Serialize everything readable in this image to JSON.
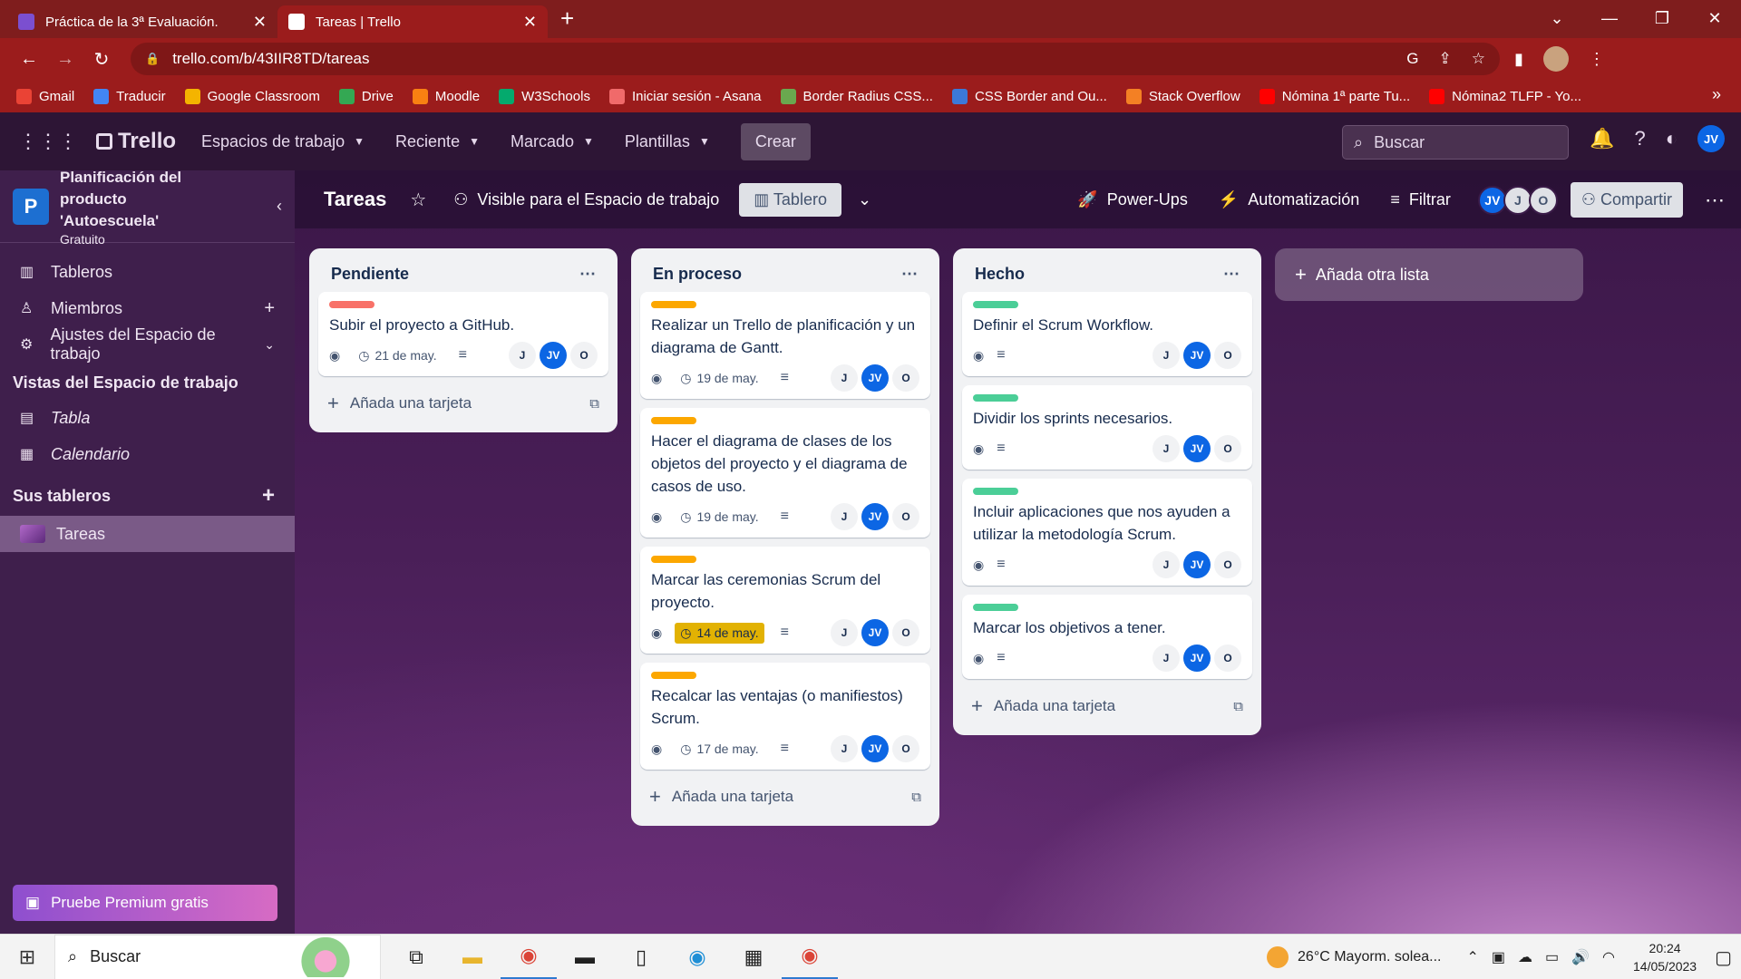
{
  "browser": {
    "tabs": [
      {
        "title": "Práctica de la 3ª Evaluación.",
        "active": false,
        "favicon_color": "#7b4fd0"
      },
      {
        "title": "Tareas | Trello",
        "active": true,
        "favicon_color": "#ffffff"
      }
    ],
    "url": "trello.com/b/43IIR8TD/tareas",
    "bookmarks": [
      {
        "label": "Gmail",
        "color": "#ea4335"
      },
      {
        "label": "Traducir",
        "color": "#4285f4"
      },
      {
        "label": "Google Classroom",
        "color": "#f4b400"
      },
      {
        "label": "Drive",
        "color": "#34a853"
      },
      {
        "label": "Moodle",
        "color": "#f98012"
      },
      {
        "label": "W3Schools",
        "color": "#04aa6d"
      },
      {
        "label": "Iniciar sesión - Asana",
        "color": "#f06a6a"
      },
      {
        "label": "Border Radius CSS...",
        "color": "#6aa84f"
      },
      {
        "label": "CSS Border and Ou...",
        "color": "#3c78d8"
      },
      {
        "label": "Stack Overflow",
        "color": "#f48024"
      },
      {
        "label": "Nómina 1ª parte Tu...",
        "color": "#ff0000"
      },
      {
        "label": "Nómina2 TLFP - Yo...",
        "color": "#ff0000"
      }
    ]
  },
  "header": {
    "logo": "Trello",
    "menus": [
      "Espacios de trabajo",
      "Reciente",
      "Marcado",
      "Plantillas"
    ],
    "create": "Crear",
    "search_placeholder": "Buscar",
    "avatar": "JV"
  },
  "sidebar": {
    "workspace_name": "Planificación del producto 'Autoescuela'",
    "workspace_initial": "P",
    "workspace_plan": "Gratuito",
    "nav": [
      "Tableros",
      "Miembros",
      "Ajustes del Espacio de trabajo"
    ],
    "views_title": "Vistas del Espacio de trabajo",
    "views": [
      "Tabla",
      "Calendario"
    ],
    "boards_title": "Sus tableros",
    "boards": [
      "Tareas"
    ],
    "premium": "Pruebe Premium gratis"
  },
  "board": {
    "title": "Tareas",
    "visibility": "Visible para el Espacio de trabajo",
    "view": "Tablero",
    "powerups": "Power-Ups",
    "automation": "Automatización",
    "filter": "Filtrar",
    "members": [
      "JV",
      "J",
      "O"
    ],
    "share": "Compartir",
    "add_list": "Añada otra lista",
    "add_card": "Añada una tarjeta"
  },
  "lists": [
    {
      "name": "Pendiente",
      "cards": [
        {
          "label_color": "#f87168",
          "title": "Subir el proyecto a GitHub.",
          "due": "21 de may.",
          "due_warn": false
        }
      ]
    },
    {
      "name": "En proceso",
      "cards": [
        {
          "label_color": "#fca700",
          "title": "Realizar un Trello de planificación y un diagrama de Gantt.",
          "due": "19 de may.",
          "due_warn": false
        },
        {
          "label_color": "#fca700",
          "title": "Hacer el diagrama de clases de los objetos del proyecto y el diagrama de casos de uso.",
          "due": "19 de may.",
          "due_warn": false
        },
        {
          "label_color": "#fca700",
          "title": "Marcar las ceremonias Scrum del proyecto.",
          "due": "14 de may.",
          "due_warn": true
        },
        {
          "label_color": "#fca700",
          "title": "Recalcar las ventajas (o manifiestos) Scrum.",
          "due": "17 de may.",
          "due_warn": false
        }
      ]
    },
    {
      "name": "Hecho",
      "cards": [
        {
          "label_color": "#4bce97",
          "title": "Definir el Scrum Workflow.",
          "due": "",
          "due_warn": false
        },
        {
          "label_color": "#4bce97",
          "title": "Dividir los sprints necesarios.",
          "due": "",
          "due_warn": false
        },
        {
          "label_color": "#4bce97",
          "title": "Incluir aplicaciones que nos ayuden a utilizar la metodología Scrum.",
          "due": "",
          "due_warn": false
        },
        {
          "label_color": "#4bce97",
          "title": "Marcar los objetivos a tener.",
          "due": "",
          "due_warn": false
        }
      ]
    }
  ],
  "card_members": [
    "J",
    "JV",
    "O"
  ],
  "taskbar": {
    "search": "Buscar",
    "weather": "26°C  Mayorm. solea...",
    "time": "20:24",
    "date": "14/05/2023"
  }
}
